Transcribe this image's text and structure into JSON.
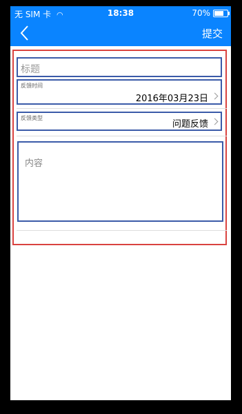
{
  "status_bar": {
    "carrier": "无 SIM 卡",
    "time": "18:38",
    "battery_percent": "70%",
    "battery_level": 0.7
  },
  "nav": {
    "submit_label": "提交",
    "back_icon": "chevron-left-icon"
  },
  "form": {
    "title_placeholder": "标题",
    "date_label": "反馈时间",
    "date_value": "2016年03月23日",
    "type_label": "反馈类型",
    "type_value": "问题反馈",
    "content_placeholder": "内容"
  },
  "colors": {
    "accent": "#0a84ff",
    "outline_red": "#d9423f",
    "outline_blue": "#3a5aa8"
  }
}
